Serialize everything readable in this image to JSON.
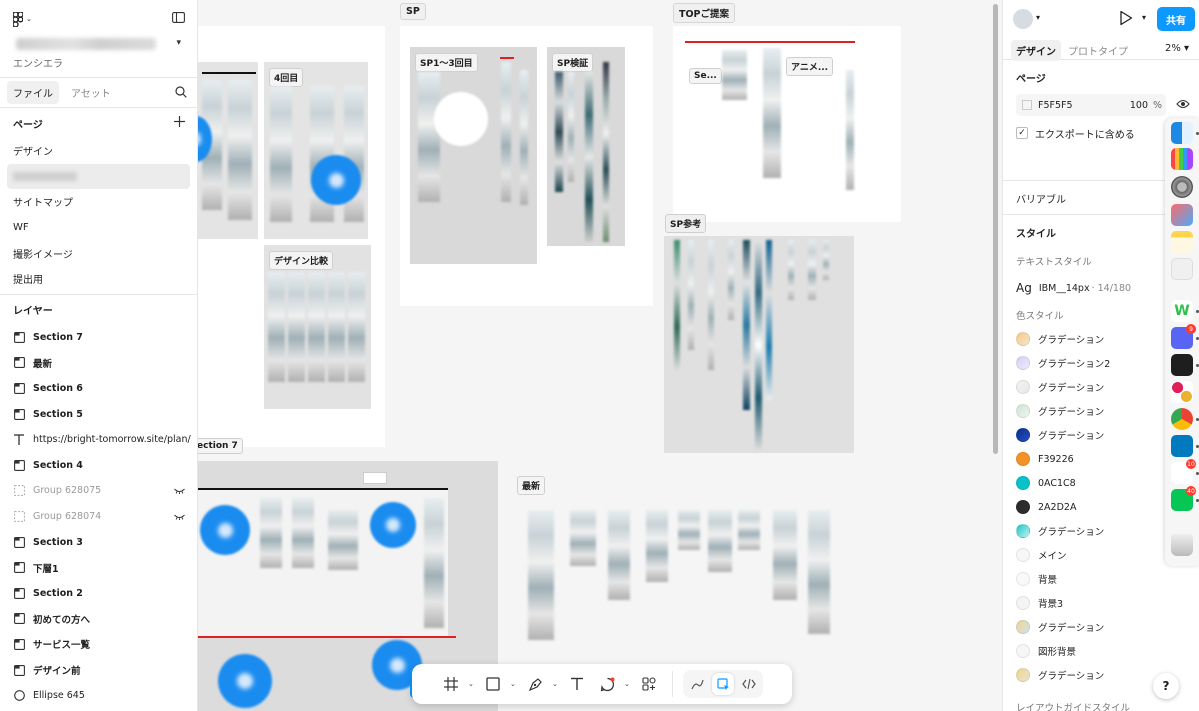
{
  "left_panel": {
    "team": "エンシエラ",
    "tabs": {
      "file": "ファイル",
      "assets": "アセット"
    },
    "pages_header": "ページ",
    "pages": [
      "デザイン",
      "",
      "サイトマップ",
      "WF",
      "撮影イメージ",
      "提出用"
    ],
    "layers_header": "レイヤー",
    "layers": [
      {
        "name": "Section 7",
        "type": "section"
      },
      {
        "name": "最新",
        "type": "section"
      },
      {
        "name": "Section 6",
        "type": "section"
      },
      {
        "name": "Section 5",
        "type": "section"
      },
      {
        "name": "https://bright-tomorrow.site/plan/",
        "type": "text"
      },
      {
        "name": "Section 4",
        "type": "section"
      },
      {
        "name": "Group 628075",
        "type": "group-hidden"
      },
      {
        "name": "Group 628074",
        "type": "group-hidden"
      },
      {
        "name": "Section 3",
        "type": "section"
      },
      {
        "name": "下層1",
        "type": "section"
      },
      {
        "name": "Section 2",
        "type": "section"
      },
      {
        "name": "初めての方へ",
        "type": "section"
      },
      {
        "name": "サービス一覧",
        "type": "section"
      },
      {
        "name": "デザイン前",
        "type": "section"
      },
      {
        "name": "Ellipse 645",
        "type": "ellipse"
      }
    ]
  },
  "canvas": {
    "labels": {
      "sp": "SP",
      "top_proposal": "TOPご提案",
      "fourth": "4回目",
      "design_compare": "デザイン比較",
      "sp_1_3": "SP1〜3回目",
      "sp_verify": "SP検証",
      "se": "Se...",
      "anime": "アニメ...",
      "sp_ref": "SP参考",
      "section7": "ection 7",
      "latest": "最新"
    }
  },
  "right_panel": {
    "share": "共有",
    "tabs": {
      "design": "デザイン",
      "prototype": "プロトタイプ"
    },
    "zoom": "2%",
    "page_header": "ページ",
    "bg_color": "F5F5F5",
    "bg_opacity": "100",
    "bg_unit": "%",
    "export_label": "エクスポートに含める",
    "variables": "バリアブル",
    "styles_header": "スタイル",
    "text_styles_header": "テキストスタイル",
    "text_style": {
      "glyph": "Ag",
      "name": "IBM__14px",
      "meta": "· 14/180"
    },
    "color_styles_header": "色スタイル",
    "color_styles": [
      {
        "name": "グラデーション",
        "color": "linear-gradient(135deg,#f5c98a,#f7e6c8)"
      },
      {
        "name": "グラデーション2",
        "color": "linear-gradient(135deg,#d6cff5,#efe9fb)"
      },
      {
        "name": "グラデーション",
        "color": "linear-gradient(135deg,#f2f2f2,#e8e8e8)"
      },
      {
        "name": "グラデーション",
        "color": "linear-gradient(135deg,#cfe3d6,#eef5ef)"
      },
      {
        "name": "グラデーション",
        "color": "linear-gradient(135deg,#0b2f8a,#2350c0)"
      },
      {
        "name": "F39226",
        "color": "#F39226"
      },
      {
        "name": "0AC1C8",
        "color": "#0AC1C8"
      },
      {
        "name": "2A2D2A",
        "color": "#2A2D2A"
      },
      {
        "name": "グラデーション",
        "color": "linear-gradient(135deg,#1fc8c8,#bdf0f0)"
      },
      {
        "name": "メイン",
        "color": "#f7f7f7"
      },
      {
        "name": "背景",
        "color": "#f9f9f9"
      },
      {
        "name": "背景3",
        "color": "#f4f4f4"
      },
      {
        "name": "グラデーション",
        "color": "linear-gradient(135deg,#f3d38f,#cfe3e8)"
      },
      {
        "name": "図形背景",
        "color": "#f6f6f6"
      },
      {
        "name": "グラデーション",
        "color": "linear-gradient(135deg,#f0d48a,#e9e6d2)"
      }
    ],
    "layout_guide": "レイアウトガイドスタイル"
  },
  "help": "?"
}
